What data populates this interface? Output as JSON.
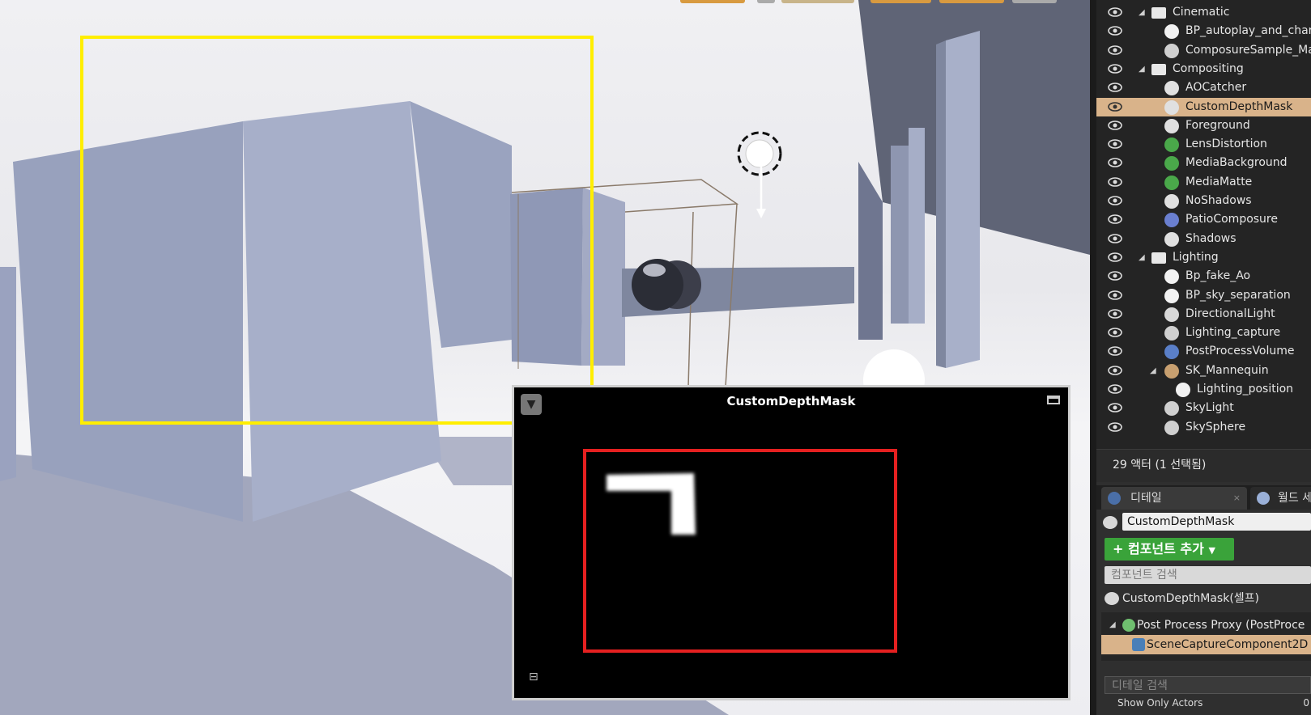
{
  "preview": {
    "title": "CustomDepthMask"
  },
  "outliner": {
    "items": [
      {
        "label": "Cinematic",
        "type": "folder",
        "expanded": true,
        "indent": 0
      },
      {
        "label": "BP_autoplay_and_char",
        "type": "blueprint",
        "indent": 1
      },
      {
        "label": "ComposureSample_Ma",
        "type": "composure",
        "indent": 1
      },
      {
        "label": "Compositing",
        "type": "folder",
        "expanded": true,
        "indent": 0
      },
      {
        "label": "AOCatcher",
        "type": "comp",
        "indent": 1
      },
      {
        "label": "CustomDepthMask",
        "type": "comp",
        "indent": 1,
        "selected": true
      },
      {
        "label": "Foreground",
        "type": "comp",
        "indent": 1
      },
      {
        "label": "LensDistortion",
        "type": "media",
        "indent": 1
      },
      {
        "label": "MediaBackground",
        "type": "media",
        "indent": 1
      },
      {
        "label": "MediaMatte",
        "type": "media",
        "indent": 1
      },
      {
        "label": "NoShadows",
        "type": "comp",
        "indent": 1
      },
      {
        "label": "PatioComposure",
        "type": "layers",
        "indent": 1
      },
      {
        "label": "Shadows",
        "type": "comp",
        "indent": 1
      },
      {
        "label": "Lighting",
        "type": "folder",
        "expanded": true,
        "indent": 0
      },
      {
        "label": "Bp_fake_Ao",
        "type": "blueprint",
        "indent": 1
      },
      {
        "label": "BP_sky_separation",
        "type": "blueprint",
        "indent": 1
      },
      {
        "label": "DirectionalLight",
        "type": "light",
        "indent": 1
      },
      {
        "label": "Lighting_capture",
        "type": "capture",
        "indent": 1
      },
      {
        "label": "PostProcessVolume",
        "type": "volume",
        "indent": 1
      },
      {
        "label": "SK_Mannequin",
        "type": "mannequin",
        "indent": 1,
        "expandable": true
      },
      {
        "label": "Lighting_position",
        "type": "blueprint",
        "indent": 2
      },
      {
        "label": "SkyLight",
        "type": "skylight",
        "indent": 1
      },
      {
        "label": "SkySphere",
        "type": "capture",
        "indent": 1
      }
    ],
    "count_text": "29 액터 (1 선택됨)"
  },
  "details": {
    "tab_details": "디테일",
    "tab_world": "월드 세",
    "actor_name": "CustomDepthMask",
    "add_component": "컴포넌트 추가",
    "component_search_placeholder": "컴포넌트 검색",
    "self_label": "CustomDepthMask(셀프)",
    "components": [
      {
        "label": "Post Process Proxy (PostProce",
        "expanded": true
      },
      {
        "label": "SceneCaptureComponent2D (",
        "selected": true
      }
    ],
    "details_search_placeholder": "디테일 검색",
    "show_only_label": "Show Only Actors",
    "show_only_value": "0"
  },
  "colors": {
    "selection": "#d9b38a",
    "yellow_frame": "#ffee00",
    "red_frame": "#e52020",
    "add_button": "#3aa33a"
  }
}
